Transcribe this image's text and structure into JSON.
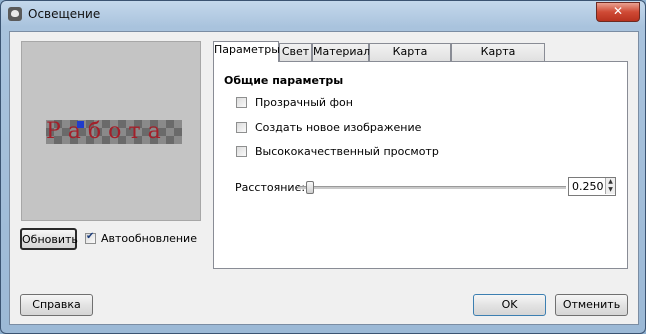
{
  "window": {
    "title": "Освещение",
    "close_label": "✕"
  },
  "preview": {
    "word": "Работа"
  },
  "left": {
    "update_button": "Обновить",
    "auto_update_label": "Автообновление",
    "auto_update_checked": true
  },
  "tabs": [
    {
      "label": "Параметры",
      "active": true
    },
    {
      "label": "Свет",
      "active": false
    },
    {
      "label": "Материал",
      "active": false
    },
    {
      "label": "Карта рельефа",
      "active": false
    },
    {
      "label": "Карта окружения",
      "active": false
    }
  ],
  "params": {
    "section_title": "Общие параметры",
    "options": [
      {
        "label": "Прозрачный фон",
        "checked": false
      },
      {
        "label": "Создать новое изображение",
        "checked": false
      },
      {
        "label": "Высококачественный просмотр",
        "checked": false
      }
    ],
    "distance_label": "Расстояние:",
    "distance_value": "0.250",
    "distance_fraction": 0.0
  },
  "footer": {
    "help": "Справка",
    "ok": "OK",
    "cancel": "Отменить"
  }
}
